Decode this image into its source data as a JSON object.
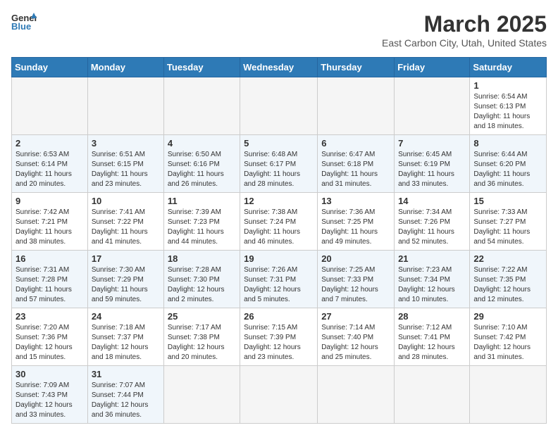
{
  "header": {
    "logo_general": "General",
    "logo_blue": "Blue",
    "month_year": "March 2025",
    "location": "East Carbon City, Utah, United States"
  },
  "weekdays": [
    "Sunday",
    "Monday",
    "Tuesday",
    "Wednesday",
    "Thursday",
    "Friday",
    "Saturday"
  ],
  "weeks": [
    [
      {
        "day": "",
        "info": ""
      },
      {
        "day": "",
        "info": ""
      },
      {
        "day": "",
        "info": ""
      },
      {
        "day": "",
        "info": ""
      },
      {
        "day": "",
        "info": ""
      },
      {
        "day": "",
        "info": ""
      },
      {
        "day": "1",
        "info": "Sunrise: 6:54 AM\nSunset: 6:13 PM\nDaylight: 11 hours\nand 18 minutes."
      }
    ],
    [
      {
        "day": "2",
        "info": "Sunrise: 6:53 AM\nSunset: 6:14 PM\nDaylight: 11 hours\nand 20 minutes."
      },
      {
        "day": "3",
        "info": "Sunrise: 6:51 AM\nSunset: 6:15 PM\nDaylight: 11 hours\nand 23 minutes."
      },
      {
        "day": "4",
        "info": "Sunrise: 6:50 AM\nSunset: 6:16 PM\nDaylight: 11 hours\nand 26 minutes."
      },
      {
        "day": "5",
        "info": "Sunrise: 6:48 AM\nSunset: 6:17 PM\nDaylight: 11 hours\nand 28 minutes."
      },
      {
        "day": "6",
        "info": "Sunrise: 6:47 AM\nSunset: 6:18 PM\nDaylight: 11 hours\nand 31 minutes."
      },
      {
        "day": "7",
        "info": "Sunrise: 6:45 AM\nSunset: 6:19 PM\nDaylight: 11 hours\nand 33 minutes."
      },
      {
        "day": "8",
        "info": "Sunrise: 6:44 AM\nSunset: 6:20 PM\nDaylight: 11 hours\nand 36 minutes."
      }
    ],
    [
      {
        "day": "9",
        "info": "Sunrise: 7:42 AM\nSunset: 7:21 PM\nDaylight: 11 hours\nand 38 minutes."
      },
      {
        "day": "10",
        "info": "Sunrise: 7:41 AM\nSunset: 7:22 PM\nDaylight: 11 hours\nand 41 minutes."
      },
      {
        "day": "11",
        "info": "Sunrise: 7:39 AM\nSunset: 7:23 PM\nDaylight: 11 hours\nand 44 minutes."
      },
      {
        "day": "12",
        "info": "Sunrise: 7:38 AM\nSunset: 7:24 PM\nDaylight: 11 hours\nand 46 minutes."
      },
      {
        "day": "13",
        "info": "Sunrise: 7:36 AM\nSunset: 7:25 PM\nDaylight: 11 hours\nand 49 minutes."
      },
      {
        "day": "14",
        "info": "Sunrise: 7:34 AM\nSunset: 7:26 PM\nDaylight: 11 hours\nand 52 minutes."
      },
      {
        "day": "15",
        "info": "Sunrise: 7:33 AM\nSunset: 7:27 PM\nDaylight: 11 hours\nand 54 minutes."
      }
    ],
    [
      {
        "day": "16",
        "info": "Sunrise: 7:31 AM\nSunset: 7:28 PM\nDaylight: 11 hours\nand 57 minutes."
      },
      {
        "day": "17",
        "info": "Sunrise: 7:30 AM\nSunset: 7:29 PM\nDaylight: 11 hours\nand 59 minutes."
      },
      {
        "day": "18",
        "info": "Sunrise: 7:28 AM\nSunset: 7:30 PM\nDaylight: 12 hours\nand 2 minutes."
      },
      {
        "day": "19",
        "info": "Sunrise: 7:26 AM\nSunset: 7:31 PM\nDaylight: 12 hours\nand 5 minutes."
      },
      {
        "day": "20",
        "info": "Sunrise: 7:25 AM\nSunset: 7:33 PM\nDaylight: 12 hours\nand 7 minutes."
      },
      {
        "day": "21",
        "info": "Sunrise: 7:23 AM\nSunset: 7:34 PM\nDaylight: 12 hours\nand 10 minutes."
      },
      {
        "day": "22",
        "info": "Sunrise: 7:22 AM\nSunset: 7:35 PM\nDaylight: 12 hours\nand 12 minutes."
      }
    ],
    [
      {
        "day": "23",
        "info": "Sunrise: 7:20 AM\nSunset: 7:36 PM\nDaylight: 12 hours\nand 15 minutes."
      },
      {
        "day": "24",
        "info": "Sunrise: 7:18 AM\nSunset: 7:37 PM\nDaylight: 12 hours\nand 18 minutes."
      },
      {
        "day": "25",
        "info": "Sunrise: 7:17 AM\nSunset: 7:38 PM\nDaylight: 12 hours\nand 20 minutes."
      },
      {
        "day": "26",
        "info": "Sunrise: 7:15 AM\nSunset: 7:39 PM\nDaylight: 12 hours\nand 23 minutes."
      },
      {
        "day": "27",
        "info": "Sunrise: 7:14 AM\nSunset: 7:40 PM\nDaylight: 12 hours\nand 25 minutes."
      },
      {
        "day": "28",
        "info": "Sunrise: 7:12 AM\nSunset: 7:41 PM\nDaylight: 12 hours\nand 28 minutes."
      },
      {
        "day": "29",
        "info": "Sunrise: 7:10 AM\nSunset: 7:42 PM\nDaylight: 12 hours\nand 31 minutes."
      }
    ],
    [
      {
        "day": "30",
        "info": "Sunrise: 7:09 AM\nSunset: 7:43 PM\nDaylight: 12 hours\nand 33 minutes."
      },
      {
        "day": "31",
        "info": "Sunrise: 7:07 AM\nSunset: 7:44 PM\nDaylight: 12 hours\nand 36 minutes."
      },
      {
        "day": "",
        "info": ""
      },
      {
        "day": "",
        "info": ""
      },
      {
        "day": "",
        "info": ""
      },
      {
        "day": "",
        "info": ""
      },
      {
        "day": "",
        "info": ""
      }
    ]
  ]
}
